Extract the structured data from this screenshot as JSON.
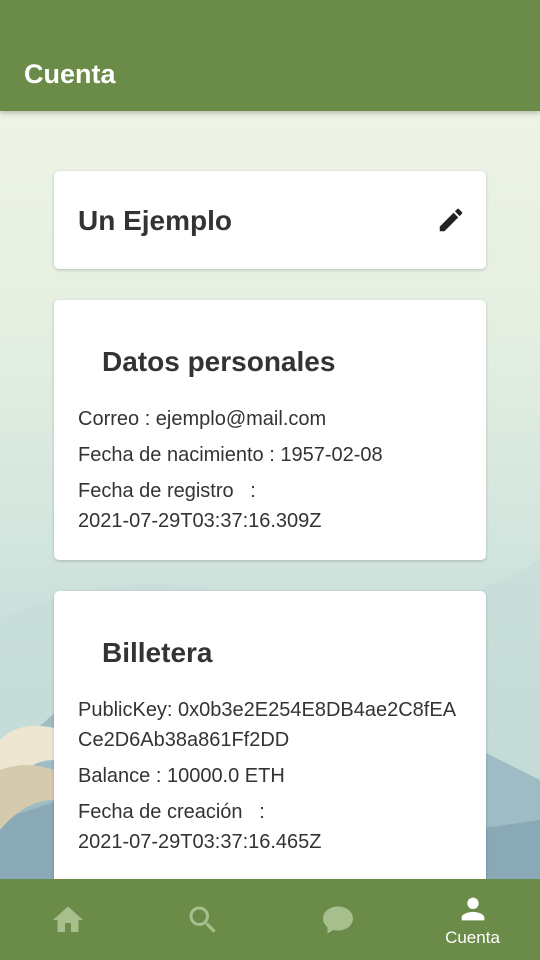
{
  "app_bar": {
    "title": "Cuenta"
  },
  "profile": {
    "name": "Un Ejemplo",
    "edit_icon": "pencil-icon"
  },
  "personal": {
    "title": "Datos personales",
    "email_line": "Correo : ejemplo@mail.com",
    "birth_line": "Fecha de nacimiento : 1957-02-08",
    "registration_label": "Fecha de registro   :",
    "registration_value": "2021-07-29T03:37:16.309Z"
  },
  "wallet": {
    "title": "Billetera",
    "public_key_line": "PublicKey: 0x0b3e2E254E8DB4ae2C8fEACe2D6Ab38a861Ff2DD",
    "balance_line": "Balance : 10000.0 ETH",
    "created_label": "Fecha de creación   :",
    "created_value": "2021-07-29T03:37:16.465Z"
  },
  "nav": {
    "items": [
      {
        "icon": "home-icon",
        "label": "",
        "active": false
      },
      {
        "icon": "search-icon",
        "label": "",
        "active": false
      },
      {
        "icon": "chat-icon",
        "label": "",
        "active": false
      },
      {
        "icon": "person-icon",
        "label": "Cuenta",
        "active": true
      }
    ]
  },
  "colors": {
    "primary": "#6a8c48",
    "inactive_icon": "#a7bf8c",
    "active_icon": "#ffffff"
  }
}
